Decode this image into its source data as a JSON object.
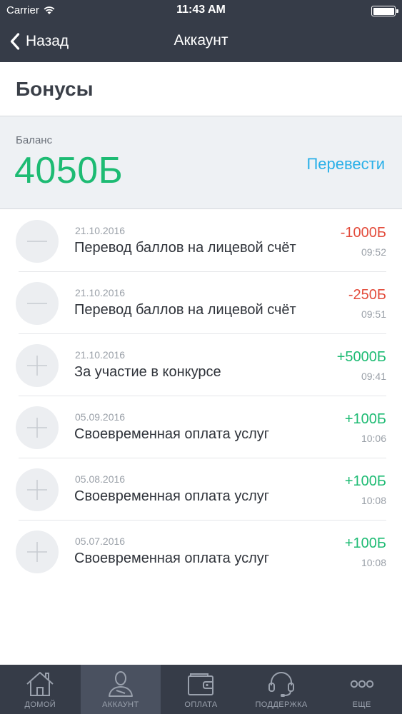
{
  "status_bar": {
    "carrier": "Carrier",
    "time": "11:43 AM"
  },
  "nav": {
    "back_label": "Назад",
    "title": "Аккаунт"
  },
  "section": {
    "title": "Бонусы"
  },
  "balance": {
    "label": "Баланс",
    "amount": "4050Б",
    "transfer_label": "Перевести"
  },
  "transactions": [
    {
      "kind": "minus",
      "date": "21.10.2016",
      "description": "Перевод баллов на лицевой счёт",
      "amount": "-1000Б",
      "time": "09:52"
    },
    {
      "kind": "minus",
      "date": "21.10.2016",
      "description": "Перевод баллов на лицевой счёт",
      "amount": "-250Б",
      "time": "09:51"
    },
    {
      "kind": "plus",
      "date": "21.10.2016",
      "description": "За участие в конкурсе",
      "amount": "+5000Б",
      "time": "09:41"
    },
    {
      "kind": "plus",
      "date": "05.09.2016",
      "description": "Своевременная оплата услуг",
      "amount": "+100Б",
      "time": "10:06"
    },
    {
      "kind": "plus",
      "date": "05.08.2016",
      "description": "Своевременная оплата услуг",
      "amount": "+100Б",
      "time": "10:08"
    },
    {
      "kind": "plus",
      "date": "05.07.2016",
      "description": "Своевременная оплата услуг",
      "amount": "+100Б",
      "time": "10:08"
    }
  ],
  "tabs": [
    {
      "label": "ДОМОЙ",
      "icon": "home-icon",
      "active": false
    },
    {
      "label": "АККАУНТ",
      "icon": "user-icon",
      "active": true
    },
    {
      "label": "ОПЛАТА",
      "icon": "wallet-icon",
      "active": false
    },
    {
      "label": "ПОДДЕРЖКА",
      "icon": "headset-icon",
      "active": false
    },
    {
      "label": "ЕЩЕ",
      "icon": "more-icon",
      "active": false
    }
  ],
  "colors": {
    "header": "#363c48",
    "positive": "#1dbb73",
    "negative": "#e34b3b",
    "link": "#2ab0e8",
    "balance_bg": "#eef1f4"
  }
}
